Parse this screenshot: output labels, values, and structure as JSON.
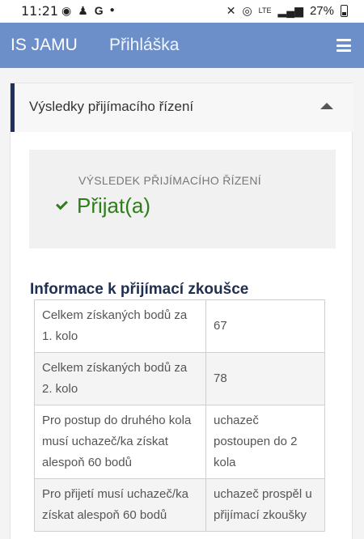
{
  "statusbar": {
    "time": "11:21",
    "left_icons": [
      "spotify-icon",
      "notification-icon",
      "google-icon",
      "dot-icon"
    ],
    "right_icons": [
      "mute-icon",
      "hotspot-icon",
      "lte-icon",
      "signal-icon"
    ],
    "battery": "27%"
  },
  "appbar": {
    "brand": "IS JAMU",
    "page_title": "Přihláška"
  },
  "accordion": {
    "title": "Výsledky přijímacího řízení",
    "expanded": true
  },
  "result": {
    "label": "VÝSLEDEK PŘIJÍMACÍHO ŘÍZENÍ",
    "value": "Přijat(a)"
  },
  "exam_info": {
    "title": "Informace k přijímací zkoušce",
    "rows": [
      {
        "key": "Celkem získaných bodů za 1. kolo",
        "value": "67"
      },
      {
        "key": "Celkem získaných bodů za 2. kolo",
        "value": "78"
      },
      {
        "key": "Pro postup do druhého kola musí uchazeč/ka získat alespoň 60 bodů",
        "value": "uchazeč postoupen do 2 kola"
      },
      {
        "key": "Pro přijetí musí uchazeč/ka získat alespoň 60 bodů",
        "value": "uchazeč prospěl u přijímací zkoušky"
      }
    ]
  },
  "colors": {
    "appbar": "#6c8ec9",
    "accent_border": "#1f2f63",
    "success": "#2f7d1c"
  }
}
